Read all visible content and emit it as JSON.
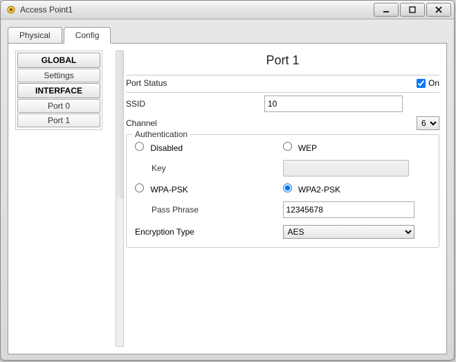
{
  "window": {
    "title": "Access Point1"
  },
  "tabs": {
    "physical": "Physical",
    "config": "Config"
  },
  "sidebar": {
    "global_header": "GLOBAL",
    "settings": "Settings",
    "interface_header": "INTERFACE",
    "port0": "Port 0",
    "port1": "Port 1"
  },
  "panel": {
    "title": "Port 1",
    "port_status_label": "Port Status",
    "port_status_on": "On",
    "ssid_label": "SSID",
    "ssid_value": "10",
    "channel_label": "Channel",
    "channel_value": "6"
  },
  "auth": {
    "legend": "Authentication",
    "disabled": "Disabled",
    "wep": "WEP",
    "key_label": "Key",
    "key_value": "",
    "wpa_psk": "WPA-PSK",
    "wpa2_psk": "WPA2-PSK",
    "passphrase_label": "Pass Phrase",
    "passphrase_value": "12345678",
    "encryption_label": "Encryption Type",
    "encryption_value": "AES"
  }
}
